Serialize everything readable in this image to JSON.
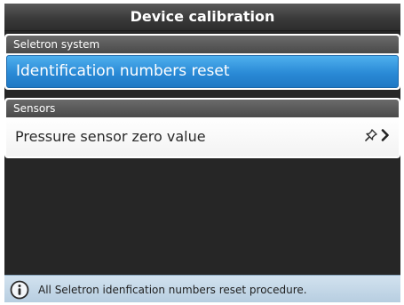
{
  "window": {
    "title": "Device calibration"
  },
  "groups": [
    {
      "header": "Seletron system",
      "items": [
        {
          "label": "Identification numbers reset",
          "selected": true
        }
      ]
    },
    {
      "header": "Sensors",
      "items": [
        {
          "label": "Pressure sensor zero value",
          "selected": false,
          "icons": [
            "pin-icon",
            "chevron-right-icon"
          ]
        }
      ]
    }
  ],
  "status": {
    "icon": "info-icon",
    "text": "All Seletron idenfication numbers reset procedure."
  },
  "colors": {
    "selection": "#2a8ad6",
    "background": "#262626",
    "status_bar": "#c4d7e8"
  }
}
